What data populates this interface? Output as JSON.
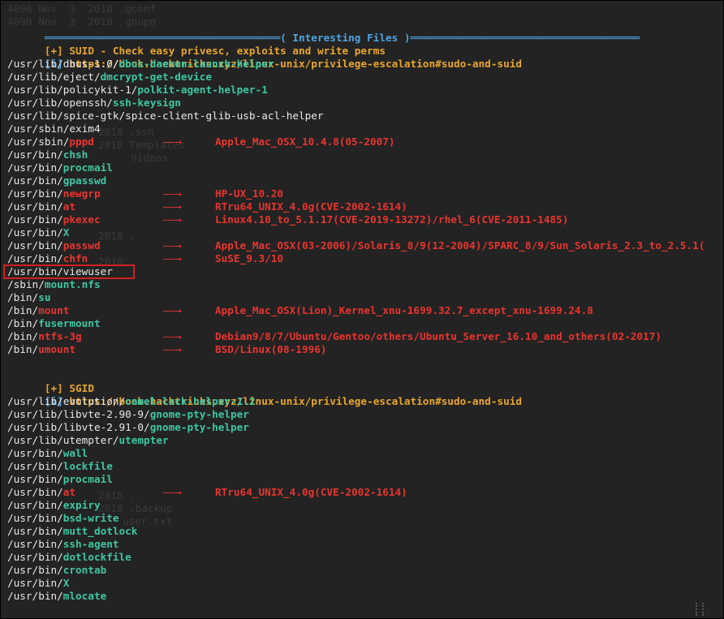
{
  "colors": {
    "background": "#232323",
    "green": "#3fc6a3",
    "red": "#e8352f",
    "orange": "#e8a52e",
    "blue": "#4ea4df",
    "white": "#e7e7e7"
  },
  "banner": {
    "left_rule": "══════════════════════════════════════",
    "title": "( Interesting Files )",
    "right_rule": "═════════════════════════════════════"
  },
  "arrow_glyph": "——→",
  "suid": {
    "header_tag": "[+]",
    "header_text": "SUID - Check easy privesc, exploits and write perms",
    "info_tag": "[i]",
    "info_url": "https://book.hacktricks.xyz/linux-unix/privilege-escalation#sudo-and-suid",
    "files": [
      {
        "dir": "/usr/lib/dbus-1.0/",
        "name": "dbus-daemon-launch-helper",
        "style": "green"
      },
      {
        "dir": "/usr/lib/eject/",
        "name": "dmcrypt-get-device",
        "style": "green"
      },
      {
        "dir": "/usr/lib/policykit-1/",
        "name": "polkit-agent-helper-1",
        "style": "green"
      },
      {
        "dir": "/usr/lib/openssh/",
        "name": "ssh-keysign",
        "style": "green"
      },
      {
        "dir": "/usr/lib/spice-gtk/",
        "name": "spice-client-glib-usb-acl-helper",
        "style": "plain"
      },
      {
        "dir": "/usr/sbin/",
        "name": "exim4",
        "style": "plain"
      },
      {
        "dir": "/usr/sbin/",
        "name": "pppd",
        "style": "red",
        "exploit": "Apple_Mac_OSX_10.4.8(05-2007)"
      },
      {
        "dir": "/usr/bin/",
        "name": "chsh",
        "style": "green"
      },
      {
        "dir": "/usr/bin/",
        "name": "procmail",
        "style": "green"
      },
      {
        "dir": "/usr/bin/",
        "name": "gpasswd",
        "style": "green"
      },
      {
        "dir": "/usr/bin/",
        "name": "newgrp",
        "style": "red",
        "exploit": "HP-UX_10.20"
      },
      {
        "dir": "/usr/bin/",
        "name": "at",
        "style": "red",
        "exploit": "RTru64_UNIX_4.0g(CVE-2002-1614)"
      },
      {
        "dir": "/usr/bin/",
        "name": "pkexec",
        "style": "red",
        "exploit": "Linux4.10_to_5.1.17(CVE-2019-13272)/rhel_6(CVE-2011-1485)"
      },
      {
        "dir": "/usr/bin/",
        "name": "X",
        "style": "green"
      },
      {
        "dir": "/usr/bin/",
        "name": "passwd",
        "style": "red",
        "exploit": "Apple_Mac_OSX(03-2006)/Solaris_8/9(12-2004)/SPARC_8/9/Sun_Solaris_2.3_to_2.5.1("
      },
      {
        "dir": "/usr/bin/",
        "name": "chfn",
        "style": "red",
        "exploit": "SuSE_9.3/10"
      },
      {
        "dir": "/usr/bin/",
        "name": "viewuser",
        "style": "plain"
      },
      {
        "dir": "/sbin/",
        "name": "mount.nfs",
        "style": "green"
      },
      {
        "dir": "/bin/",
        "name": "su",
        "style": "green"
      },
      {
        "dir": "/bin/",
        "name": "mount",
        "style": "red",
        "exploit": "Apple_Mac_OSX(Lion)_Kernel_xnu-1699.32.7_except_xnu-1699.24.8"
      },
      {
        "dir": "/bin/",
        "name": "fusermount",
        "style": "green"
      },
      {
        "dir": "/bin/",
        "name": "ntfs-3g",
        "style": "red",
        "exploit": "Debian9/8/7/Ubuntu/Gentoo/others/Ubuntu_Server_16.10_and_others(02-2017)"
      },
      {
        "dir": "/bin/",
        "name": "umount",
        "style": "red",
        "exploit": "BSD/Linux(08-1996)"
      }
    ]
  },
  "sgid": {
    "header_tag": "[+]",
    "header_text": "SGID",
    "info_tag": "[i]",
    "info_url": "https://book.hacktricks.xyz/linux-unix/privilege-escalation#sudo-and-suid",
    "files": [
      {
        "dir": "/usr/lib/evolution/",
        "name": "camel-lock-helper-1.2",
        "style": "green"
      },
      {
        "dir": "/usr/lib/libvte-2.90-9/",
        "name": "gnome-pty-helper",
        "style": "green"
      },
      {
        "dir": "/usr/lib/libvte-2.91-0/",
        "name": "gnome-pty-helper",
        "style": "green"
      },
      {
        "dir": "/usr/lib/utempter/",
        "name": "utempter",
        "style": "green"
      },
      {
        "dir": "/usr/bin/",
        "name": "wall",
        "style": "green"
      },
      {
        "dir": "/usr/bin/",
        "name": "lockfile",
        "style": "green"
      },
      {
        "dir": "/usr/bin/",
        "name": "procmail",
        "style": "green"
      },
      {
        "dir": "/usr/bin/",
        "name": "at",
        "style": "red",
        "exploit": "RTru64_UNIX_4.0g(CVE-2002-1614)"
      },
      {
        "dir": "/usr/bin/",
        "name": "expiry",
        "style": "green"
      },
      {
        "dir": "/usr/bin/",
        "name": "bsd-write",
        "style": "green"
      },
      {
        "dir": "/usr/bin/",
        "name": "mutt_dotlock",
        "style": "green"
      },
      {
        "dir": "/usr/bin/",
        "name": "ssh-agent",
        "style": "green"
      },
      {
        "dir": "/usr/bin/",
        "name": "dotlockfile",
        "style": "green"
      },
      {
        "dir": "/usr/bin/",
        "name": "crontab",
        "style": "green"
      },
      {
        "dir": "/usr/bin/",
        "name": "X",
        "style": "green"
      },
      {
        "dir": "/usr/bin/",
        "name": "mlocate",
        "style": "green"
      }
    ]
  },
  "ghost_text": [
    "4096 Nov  3  2018 .gconf",
    "4096 Nov  3  2018 .gnupg",
    "2018 .ssh",
    "2018 Templates",
    "Videos",
    "2018 .",
    "2018 .",
    "2018 ..",
    "2018 .backup",
    "user.txt"
  ]
}
